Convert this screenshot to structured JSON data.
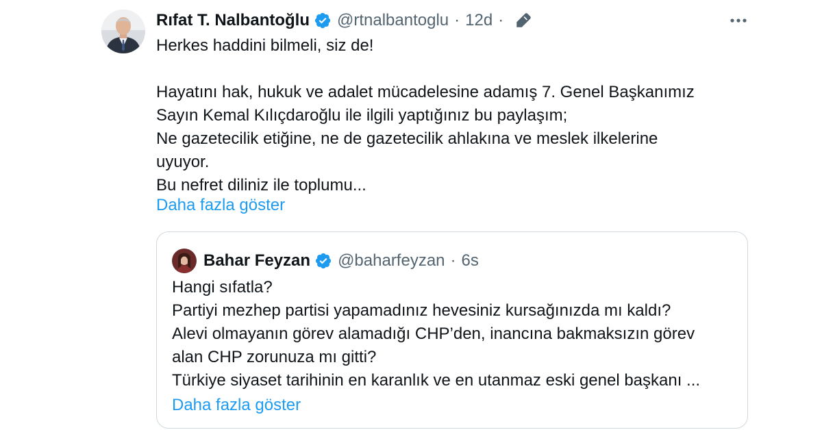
{
  "colors": {
    "text": "#0f1419",
    "muted": "#536471",
    "link": "#1d9bf0",
    "verified": "#1d9bf0",
    "border": "#cfd9de"
  },
  "tweet": {
    "author": {
      "display_name": "Rıfat T. Nalbantoğlu",
      "handle": "@rtnalbantoglu",
      "avatar_icon": "user-avatar",
      "verified_icon": "verified-badge-icon"
    },
    "separator": "·",
    "time": "12d",
    "separator2": "·",
    "edited_icon": "pencil-edit-icon",
    "more_icon": "more-horizontal-icon",
    "more_glyph": "•••",
    "lines": [
      "Herkes haddini bilmeli, siz de!",
      "",
      "Hayatını hak, hukuk ve adalet mücadelesine adamış 7. Genel Başkanımız",
      "Sayın Kemal Kılıçdaroğlu ile ilgili yaptığınız bu paylaşım;",
      "Ne gazetecilik etiğine, ne de gazetecilik ahlakına ve meslek ilkelerine",
      "uyuyor.",
      "Bu nefret diliniz ile toplumu..."
    ],
    "show_more_label": "Daha fazla göster"
  },
  "quote": {
    "author": {
      "display_name": "Bahar Feyzan",
      "handle": "@baharfeyzan",
      "avatar_icon": "user-avatar",
      "verified_icon": "verified-badge-icon"
    },
    "separator": "·",
    "time": "6s",
    "lines": [
      "Hangi sıfatla?",
      "Partiyi mezhep partisi yapamadınız hevesiniz kursağınızda mı kaldı?",
      "Alevi olmayanın görev alamadığı CHP’den, inancına bakmaksızın görev",
      "alan CHP zorunuza mı gitti?",
      "Türkiye siyaset tarihinin en karanlık ve en utanmaz eski genel başkanı ..."
    ],
    "show_more_label": "Daha fazla göster"
  }
}
